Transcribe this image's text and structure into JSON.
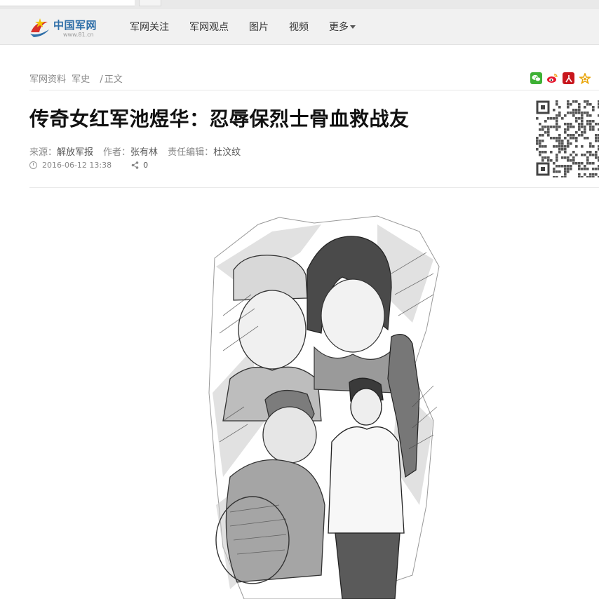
{
  "site": {
    "logo_text": "中国军网",
    "logo_url_text": "www.81.cn"
  },
  "nav": {
    "items": [
      "军网关注",
      "军网观点",
      "图片",
      "视频"
    ],
    "more_label": "更多"
  },
  "breadcrumb": {
    "items": [
      "军网资料",
      "军史"
    ],
    "separator": "/",
    "current": "正文"
  },
  "share_icons": [
    "wechat-icon",
    "weibo-icon",
    "people-icon",
    "favorite-star-icon"
  ],
  "article": {
    "title": "传奇女红军池煜华：忍辱保烈士骨血救战友",
    "source_label": "来源：",
    "source": "解放军报",
    "author_label": "作者：",
    "author": "张有林",
    "editor_label": "责任编辑：",
    "editor": "杜汶纹",
    "datetime": "2016-06-12 13:38",
    "share_count": "0"
  },
  "colors": {
    "nav_bg": "#f1f1f1",
    "logo_blue": "#2f6fa8",
    "logo_red": "#d9302a",
    "title": "#111111",
    "meta": "#888888"
  }
}
